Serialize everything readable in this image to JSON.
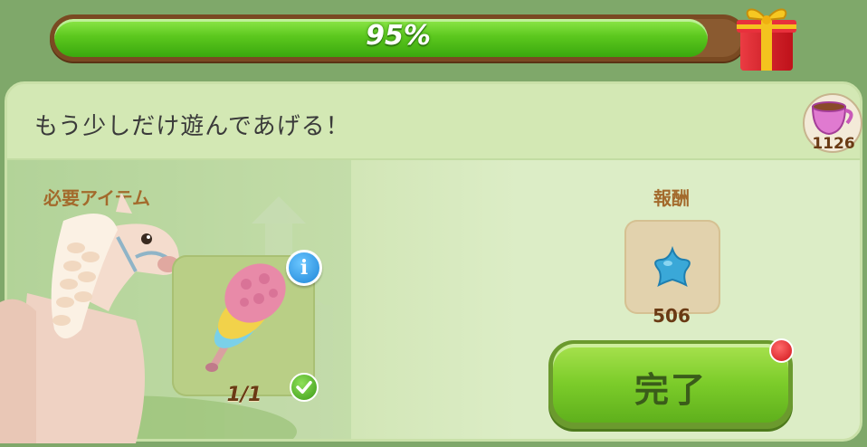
{
  "progress": {
    "percent_label": "95%",
    "value": 0.95
  },
  "currency": {
    "count": "1126",
    "icon": "teacup-icon"
  },
  "panel": {
    "title": "もう少しだけ遊んであげる！"
  },
  "requirement": {
    "label": "必要アイテム",
    "item_icon": "feather-duster-icon",
    "count": "1/1",
    "completed": true
  },
  "reward": {
    "label": "報酬",
    "icon": "blue-star-icon",
    "count": "506"
  },
  "actions": {
    "complete_label": "完了"
  },
  "colors": {
    "progress_fill": "#5cc81e",
    "button_green": "#7ccc2a",
    "label_brown": "#a36a2c",
    "panel_bg": "#dcecc0"
  }
}
